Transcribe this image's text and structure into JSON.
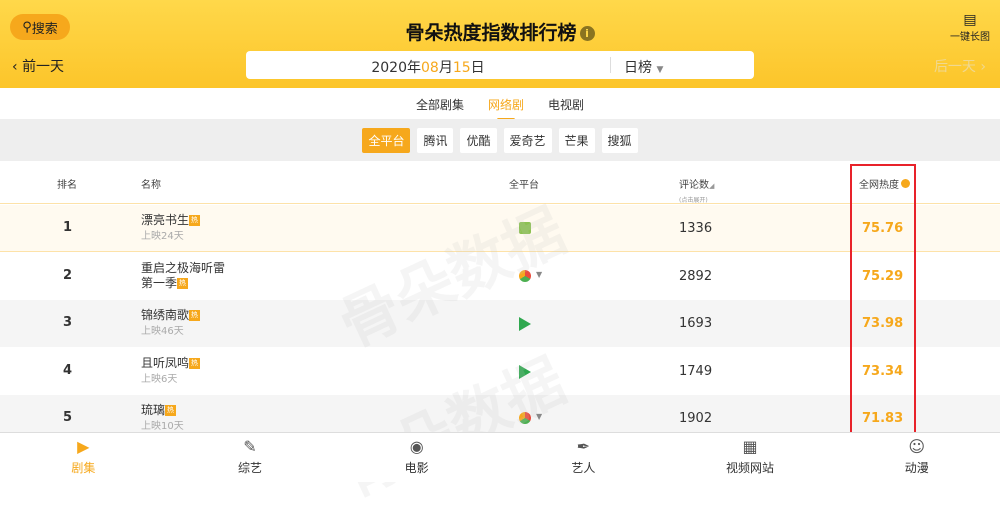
{
  "header": {
    "search_label": "搜索",
    "title": "骨朵热度指数排行榜",
    "long_image_label": "一键长图",
    "prev_day": "前一天",
    "next_day": "后一天",
    "date": {
      "year": "2020",
      "year_suffix": "年",
      "month": "08",
      "month_suffix": "月",
      "day": "15",
      "day_suffix": "日"
    },
    "rank_type": "日榜"
  },
  "category_tabs": [
    "全部剧集",
    "网络剧",
    "电视剧"
  ],
  "platform_tabs": [
    "全平台",
    "腾讯",
    "优酷",
    "爱奇艺",
    "芒果",
    "搜狐"
  ],
  "table": {
    "headers": {
      "rank": "排名",
      "name": "名称",
      "platform": "全平台",
      "comments": "评论数",
      "comments_hint": "(点击展开)",
      "heat": "全网热度"
    },
    "rows": [
      {
        "rank": "1",
        "name": "漂亮书生",
        "days": "上映24天",
        "platform": "iqiyi",
        "comments": "1336",
        "heat": "75.76"
      },
      {
        "rank": "2",
        "name": "重启之极海听雷",
        "name2": "第一季",
        "platform": "multi",
        "comments": "2892",
        "heat": "75.29"
      },
      {
        "rank": "3",
        "name": "锦绣南歌",
        "days": "上映46天",
        "platform": "tencent",
        "comments": "1693",
        "heat": "73.98"
      },
      {
        "rank": "4",
        "name": "且听凤鸣",
        "days": "上映6天",
        "platform": "tencent",
        "comments": "1749",
        "heat": "73.34"
      },
      {
        "rank": "5",
        "name": "琉璃",
        "days": "上映10天",
        "platform": "multi",
        "comments": "1902",
        "heat": "71.83"
      }
    ],
    "hot_badge": "热"
  },
  "watermark": "骨朵数据",
  "footer": [
    "剧集",
    "综艺",
    "电影",
    "艺人",
    "视频网站",
    "动漫"
  ],
  "colors": {
    "accent": "#f6a81c",
    "highlight": "#e8222a"
  }
}
